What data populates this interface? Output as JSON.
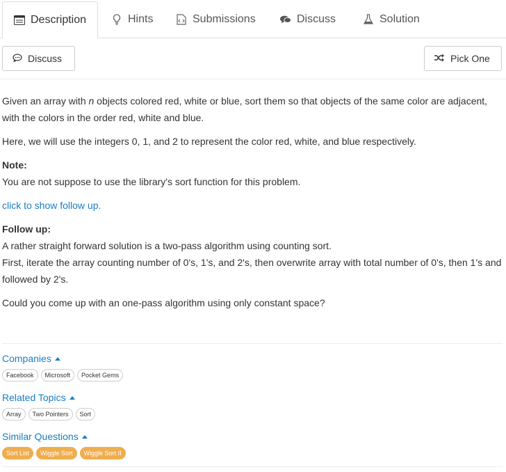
{
  "tabs": [
    {
      "label": "Description",
      "icon": "description-icon",
      "active": true
    },
    {
      "label": "Hints",
      "icon": "lightbulb-icon"
    },
    {
      "label": "Submissions",
      "icon": "code-file-icon"
    },
    {
      "label": "Discuss",
      "icon": "comments-icon"
    },
    {
      "label": "Solution",
      "icon": "flask-icon"
    }
  ],
  "toolbar": {
    "discuss_label": "Discuss",
    "pick_one_label": "Pick One"
  },
  "problem": {
    "intro_before": "Given an array with ",
    "intro_italic": "n",
    "intro_after": " objects colored red, white or blue, sort them so that objects of the same color are adjacent, with the colors in the order red, white and blue.",
    "integers_line": "Here, we will use the integers 0, 1, and 2 to represent the color red, white, and blue respectively.",
    "note_heading": "Note:",
    "note_text": "You are not suppose to use the library's sort function for this problem.",
    "follow_up_link": "click to show follow up.",
    "follow_up_heading": "Follow up:",
    "follow_up_line1": "A rather straight forward solution is a two-pass algorithm using counting sort.",
    "follow_up_line2": "First, iterate the array counting number of 0's, 1's, and 2's, then overwrite array with total number of 0's, then 1's and followed by 2's.",
    "question": "Could you come up with an one-pass algorithm using only constant space?"
  },
  "companies": {
    "title": "Companies",
    "tags": [
      "Facebook",
      "Microsoft",
      "Pocket Gems"
    ]
  },
  "related_topics": {
    "title": "Related Topics",
    "tags": [
      "Array",
      "Two Pointers",
      "Sort"
    ]
  },
  "similar_questions": {
    "title": "Similar Questions",
    "tags": [
      "Sort List",
      "Wiggle Sort",
      "Wiggle Sort II"
    ]
  },
  "colors": {
    "link": "#1a7cc2",
    "tag_orange": "#f0ad4e",
    "border": "#dddddd"
  }
}
